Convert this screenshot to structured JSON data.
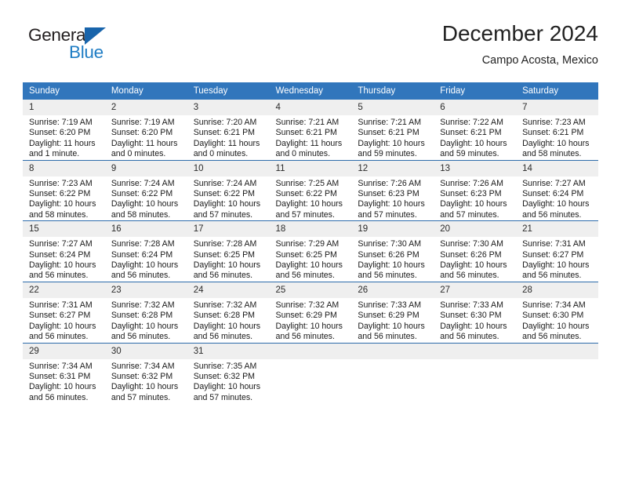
{
  "brand": {
    "name_part1": "General",
    "name_part2": "Blue",
    "triangle_icon": "triangle-icon",
    "color_dark": "#231f20",
    "color_blue": "#1f7dc4"
  },
  "header": {
    "title": "December 2024",
    "subtitle": "Campo Acosta, Mexico"
  },
  "theme": {
    "header_bg": "#3176bc",
    "header_text": "#ffffff",
    "row_divider": "#2d6cab",
    "daynum_bg": "#efefef",
    "body_text": "#1a1a1a"
  },
  "weekdays": [
    "Sunday",
    "Monday",
    "Tuesday",
    "Wednesday",
    "Thursday",
    "Friday",
    "Saturday"
  ],
  "weeks": [
    [
      {
        "day": "1",
        "sunrise": "Sunrise: 7:19 AM",
        "sunset": "Sunset: 6:20 PM",
        "daylight1": "Daylight: 11 hours",
        "daylight2": "and 1 minute."
      },
      {
        "day": "2",
        "sunrise": "Sunrise: 7:19 AM",
        "sunset": "Sunset: 6:20 PM",
        "daylight1": "Daylight: 11 hours",
        "daylight2": "and 0 minutes."
      },
      {
        "day": "3",
        "sunrise": "Sunrise: 7:20 AM",
        "sunset": "Sunset: 6:21 PM",
        "daylight1": "Daylight: 11 hours",
        "daylight2": "and 0 minutes."
      },
      {
        "day": "4",
        "sunrise": "Sunrise: 7:21 AM",
        "sunset": "Sunset: 6:21 PM",
        "daylight1": "Daylight: 11 hours",
        "daylight2": "and 0 minutes."
      },
      {
        "day": "5",
        "sunrise": "Sunrise: 7:21 AM",
        "sunset": "Sunset: 6:21 PM",
        "daylight1": "Daylight: 10 hours",
        "daylight2": "and 59 minutes."
      },
      {
        "day": "6",
        "sunrise": "Sunrise: 7:22 AM",
        "sunset": "Sunset: 6:21 PM",
        "daylight1": "Daylight: 10 hours",
        "daylight2": "and 59 minutes."
      },
      {
        "day": "7",
        "sunrise": "Sunrise: 7:23 AM",
        "sunset": "Sunset: 6:21 PM",
        "daylight1": "Daylight: 10 hours",
        "daylight2": "and 58 minutes."
      }
    ],
    [
      {
        "day": "8",
        "sunrise": "Sunrise: 7:23 AM",
        "sunset": "Sunset: 6:22 PM",
        "daylight1": "Daylight: 10 hours",
        "daylight2": "and 58 minutes."
      },
      {
        "day": "9",
        "sunrise": "Sunrise: 7:24 AM",
        "sunset": "Sunset: 6:22 PM",
        "daylight1": "Daylight: 10 hours",
        "daylight2": "and 58 minutes."
      },
      {
        "day": "10",
        "sunrise": "Sunrise: 7:24 AM",
        "sunset": "Sunset: 6:22 PM",
        "daylight1": "Daylight: 10 hours",
        "daylight2": "and 57 minutes."
      },
      {
        "day": "11",
        "sunrise": "Sunrise: 7:25 AM",
        "sunset": "Sunset: 6:22 PM",
        "daylight1": "Daylight: 10 hours",
        "daylight2": "and 57 minutes."
      },
      {
        "day": "12",
        "sunrise": "Sunrise: 7:26 AM",
        "sunset": "Sunset: 6:23 PM",
        "daylight1": "Daylight: 10 hours",
        "daylight2": "and 57 minutes."
      },
      {
        "day": "13",
        "sunrise": "Sunrise: 7:26 AM",
        "sunset": "Sunset: 6:23 PM",
        "daylight1": "Daylight: 10 hours",
        "daylight2": "and 57 minutes."
      },
      {
        "day": "14",
        "sunrise": "Sunrise: 7:27 AM",
        "sunset": "Sunset: 6:24 PM",
        "daylight1": "Daylight: 10 hours",
        "daylight2": "and 56 minutes."
      }
    ],
    [
      {
        "day": "15",
        "sunrise": "Sunrise: 7:27 AM",
        "sunset": "Sunset: 6:24 PM",
        "daylight1": "Daylight: 10 hours",
        "daylight2": "and 56 minutes."
      },
      {
        "day": "16",
        "sunrise": "Sunrise: 7:28 AM",
        "sunset": "Sunset: 6:24 PM",
        "daylight1": "Daylight: 10 hours",
        "daylight2": "and 56 minutes."
      },
      {
        "day": "17",
        "sunrise": "Sunrise: 7:28 AM",
        "sunset": "Sunset: 6:25 PM",
        "daylight1": "Daylight: 10 hours",
        "daylight2": "and 56 minutes."
      },
      {
        "day": "18",
        "sunrise": "Sunrise: 7:29 AM",
        "sunset": "Sunset: 6:25 PM",
        "daylight1": "Daylight: 10 hours",
        "daylight2": "and 56 minutes."
      },
      {
        "day": "19",
        "sunrise": "Sunrise: 7:30 AM",
        "sunset": "Sunset: 6:26 PM",
        "daylight1": "Daylight: 10 hours",
        "daylight2": "and 56 minutes."
      },
      {
        "day": "20",
        "sunrise": "Sunrise: 7:30 AM",
        "sunset": "Sunset: 6:26 PM",
        "daylight1": "Daylight: 10 hours",
        "daylight2": "and 56 minutes."
      },
      {
        "day": "21",
        "sunrise": "Sunrise: 7:31 AM",
        "sunset": "Sunset: 6:27 PM",
        "daylight1": "Daylight: 10 hours",
        "daylight2": "and 56 minutes."
      }
    ],
    [
      {
        "day": "22",
        "sunrise": "Sunrise: 7:31 AM",
        "sunset": "Sunset: 6:27 PM",
        "daylight1": "Daylight: 10 hours",
        "daylight2": "and 56 minutes."
      },
      {
        "day": "23",
        "sunrise": "Sunrise: 7:32 AM",
        "sunset": "Sunset: 6:28 PM",
        "daylight1": "Daylight: 10 hours",
        "daylight2": "and 56 minutes."
      },
      {
        "day": "24",
        "sunrise": "Sunrise: 7:32 AM",
        "sunset": "Sunset: 6:28 PM",
        "daylight1": "Daylight: 10 hours",
        "daylight2": "and 56 minutes."
      },
      {
        "day": "25",
        "sunrise": "Sunrise: 7:32 AM",
        "sunset": "Sunset: 6:29 PM",
        "daylight1": "Daylight: 10 hours",
        "daylight2": "and 56 minutes."
      },
      {
        "day": "26",
        "sunrise": "Sunrise: 7:33 AM",
        "sunset": "Sunset: 6:29 PM",
        "daylight1": "Daylight: 10 hours",
        "daylight2": "and 56 minutes."
      },
      {
        "day": "27",
        "sunrise": "Sunrise: 7:33 AM",
        "sunset": "Sunset: 6:30 PM",
        "daylight1": "Daylight: 10 hours",
        "daylight2": "and 56 minutes."
      },
      {
        "day": "28",
        "sunrise": "Sunrise: 7:34 AM",
        "sunset": "Sunset: 6:30 PM",
        "daylight1": "Daylight: 10 hours",
        "daylight2": "and 56 minutes."
      }
    ],
    [
      {
        "day": "29",
        "sunrise": "Sunrise: 7:34 AM",
        "sunset": "Sunset: 6:31 PM",
        "daylight1": "Daylight: 10 hours",
        "daylight2": "and 56 minutes."
      },
      {
        "day": "30",
        "sunrise": "Sunrise: 7:34 AM",
        "sunset": "Sunset: 6:32 PM",
        "daylight1": "Daylight: 10 hours",
        "daylight2": "and 57 minutes."
      },
      {
        "day": "31",
        "sunrise": "Sunrise: 7:35 AM",
        "sunset": "Sunset: 6:32 PM",
        "daylight1": "Daylight: 10 hours",
        "daylight2": "and 57 minutes."
      },
      {
        "day": "",
        "sunrise": "",
        "sunset": "",
        "daylight1": "",
        "daylight2": ""
      },
      {
        "day": "",
        "sunrise": "",
        "sunset": "",
        "daylight1": "",
        "daylight2": ""
      },
      {
        "day": "",
        "sunrise": "",
        "sunset": "",
        "daylight1": "",
        "daylight2": ""
      },
      {
        "day": "",
        "sunrise": "",
        "sunset": "",
        "daylight1": "",
        "daylight2": ""
      }
    ]
  ]
}
